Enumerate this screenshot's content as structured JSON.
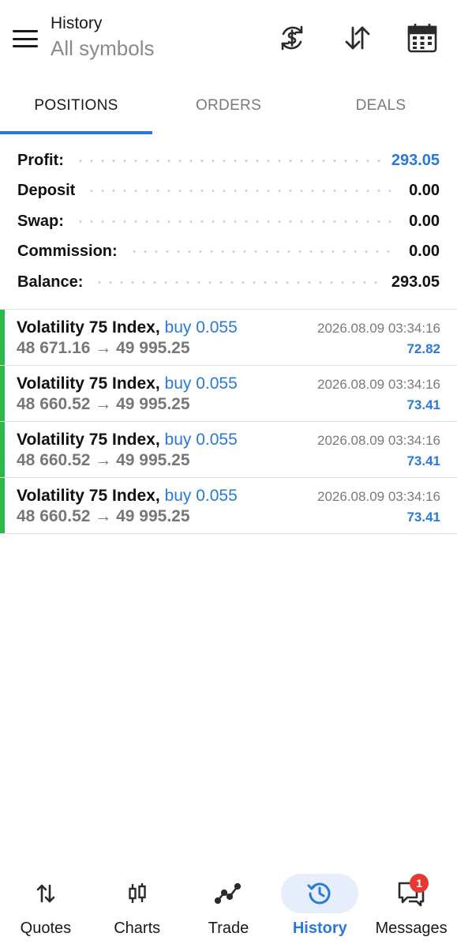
{
  "header": {
    "title": "History",
    "subtitle": "All symbols"
  },
  "tabs": [
    {
      "label": "POSITIONS",
      "active": true
    },
    {
      "label": "ORDERS",
      "active": false
    },
    {
      "label": "DEALS",
      "active": false
    }
  ],
  "summary": [
    {
      "label": "Profit:",
      "value": "293.05"
    },
    {
      "label": "Deposit",
      "value": "0.00"
    },
    {
      "label": "Swap:",
      "value": "0.00"
    },
    {
      "label": "Commission:",
      "value": "0.00"
    },
    {
      "label": "Balance:",
      "value": "293.05"
    }
  ],
  "positions": [
    {
      "symbol": "Volatility 75 Index,",
      "side": "buy 0.055",
      "prices": "48 671.16 → 49 995.25",
      "time": "2026.08.09 03:34:16",
      "profit": "72.82"
    },
    {
      "symbol": "Volatility 75 Index,",
      "side": "buy 0.055",
      "prices": "48 660.52 → 49 995.25",
      "time": "2026.08.09 03:34:16",
      "profit": "73.41"
    },
    {
      "symbol": "Volatility 75 Index,",
      "side": "buy 0.055",
      "prices": "48 660.52 → 49 995.25",
      "time": "2026.08.09 03:34:16",
      "profit": "73.41"
    },
    {
      "symbol": "Volatility 75 Index,",
      "side": "buy 0.055",
      "prices": "48 660.52 → 49 995.25",
      "time": "2026.08.09 03:34:16",
      "profit": "73.41"
    }
  ],
  "nav": {
    "items": [
      {
        "label": "Quotes",
        "icon": "quotes-arrows-icon"
      },
      {
        "label": "Charts",
        "icon": "candlestick-icon"
      },
      {
        "label": "Trade",
        "icon": "trade-line-icon"
      },
      {
        "label": "History",
        "icon": "history-clock-icon",
        "active": true
      },
      {
        "label": "Messages",
        "icon": "chat-bubbles-icon",
        "badge": "1"
      }
    ]
  },
  "colors": {
    "accent": "#2979d9",
    "buy_bar": "#2eb84b",
    "badge": "#e53935"
  }
}
